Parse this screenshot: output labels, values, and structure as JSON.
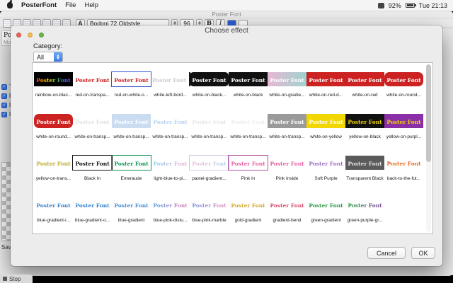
{
  "menubar": {
    "app_name": "PosterFont",
    "menus": [
      "File",
      "Help"
    ],
    "battery_percent": "92%",
    "clock": "Tue 21:13"
  },
  "window": {
    "title": "Poster Font",
    "toolbar": {
      "icons": [
        "new-document-icon",
        "open-icon",
        "save-icon",
        "export-icon",
        "color-icon",
        "effects-icon",
        "image-icon"
      ],
      "font_panel_label": "A",
      "font_name": "Bodoni 72 Oldstyle",
      "font_size": "96",
      "bold_label": "B",
      "italic_label": "I"
    },
    "sidebar": {
      "preview_text": "PosterFont",
      "multiline_label": "Multiline",
      "options": [
        {
          "label": "Text [M...",
          "checked": true
        },
        {
          "label": "Border",
          "checked": true
        },
        {
          "label": "Round",
          "checked": true
        },
        {
          "label": "Drop Sh...",
          "checked": true
        }
      ],
      "save_label": "Save in..."
    },
    "status": {
      "stop_label": "Stop"
    }
  },
  "dialog": {
    "title": "Choose effect",
    "category_label": "Category:",
    "category_value": "All",
    "cancel_label": "Cancel",
    "ok_label": "OK",
    "sample_text": "Poster Font",
    "effects": [
      {
        "label": "rainbow-on-blac...",
        "fg": "linear-gradient(90deg,#ff3333,#ffaa00,#ffee00,#33bb33,#3366ff,#aa44cc)",
        "bg": "#000000"
      },
      {
        "label": "red-on-transpa...",
        "fg": "#cc2222"
      },
      {
        "label": "red-on-white-o...",
        "fg": "#cc2222",
        "bg": "#ffffff",
        "border": "1px solid #3355cc"
      },
      {
        "label": "white-left-bord...",
        "fg": "#cccccc",
        "vbar": true
      },
      {
        "label": "white-on-black...",
        "fg": "#ffffff",
        "bg": "#111111",
        "radius": 5
      },
      {
        "label": "white-on-black",
        "fg": "#ffffff",
        "bg": "#111111"
      },
      {
        "label": "white-on-gradie...",
        "fg": "#ffffff",
        "bg": "linear-gradient(90deg,#e9b7d4,#9fd4cf)"
      },
      {
        "label": "white-on-red-d...",
        "fg": "#ffffff",
        "bg": "#cc2222"
      },
      {
        "label": "white-on-red",
        "fg": "#ffffff",
        "bg": "#cc2222"
      },
      {
        "label": "white-on-round...",
        "fg": "#ffffff",
        "bg": "#cc2222",
        "radius": 7
      },
      {
        "label": "white-on-round...",
        "fg": "#ffffff",
        "bg": "#cc2222",
        "radius": 7
      },
      {
        "label": "white-on-transp...",
        "fg": "#e2e2e2"
      },
      {
        "label": "white-on-transp...",
        "fg": "#ffffff",
        "bg": "#c9dcf0"
      },
      {
        "label": "white-on-transp...",
        "fg": "#b9d2ec"
      },
      {
        "label": "white-on-transp...",
        "fg": "#e6e6e6"
      },
      {
        "label": "white-on-transp...",
        "fg": "#ededed"
      },
      {
        "label": "white-on-transp...",
        "fg": "#ffffff",
        "bg": "#9a9a9a"
      },
      {
        "label": "white-on-yellow",
        "fg": "#ffffff",
        "bg": "#f2d600"
      },
      {
        "label": "yellow-on-black",
        "fg": "#f2d600",
        "bg": "#111111"
      },
      {
        "label": "yellow-on-purpl...",
        "fg": "#f2d600",
        "bg": "#8a2fa8"
      },
      {
        "label": "yellow-on-trans...",
        "fg": "#e0cc3e",
        "shadow": true
      },
      {
        "label": "Black In",
        "fg": "#111111",
        "border": "1px solid #111111"
      },
      {
        "label": "Emeraude",
        "fg": "#0e9455",
        "border": "1px solid #0e9455"
      },
      {
        "label": "light-blue-to-pi...",
        "fg": "linear-gradient(90deg,#8fd0ec,#f0b0d0)"
      },
      {
        "label": "pastel-gradient...",
        "fg": "linear-gradient(90deg,#f0c0d8,#b0d0ec)",
        "border": "1px solid #d4c4ea"
      },
      {
        "label": "Pink In",
        "fg": "#e860a0",
        "border": "1px solid #b050a0"
      },
      {
        "label": "Pink Inside",
        "fg": "#e860a0"
      },
      {
        "label": "Soft Purple",
        "fg": "#9a70c0"
      },
      {
        "label": "Transparent Black",
        "fg": "#e2e2e2",
        "bg": "#5a5a5a"
      },
      {
        "label": "back-to-the-fut...",
        "fg": "linear-gradient(180deg,#e03020,#f0a020)"
      },
      {
        "label": "blue-gradient-i...",
        "fg": "linear-gradient(180deg,#55b8e8,#2050b0)"
      },
      {
        "label": "blue-gradient-o...",
        "fg": "linear-gradient(180deg,#55b8e8,#2050b0)"
      },
      {
        "label": "blue-gradient",
        "fg": "linear-gradient(180deg,#66c4ee,#2860c0)"
      },
      {
        "label": "blue-pink-distu...",
        "fg": "linear-gradient(90deg,#58a8e0,#e878b8)"
      },
      {
        "label": "blue-pink-marble",
        "fg": "linear-gradient(90deg,#7898d8,#e890c0)"
      },
      {
        "label": "gold-gradient",
        "fg": "linear-gradient(180deg,#f0d060,#b8860b)"
      },
      {
        "label": "gradient-bend",
        "fg": "linear-gradient(180deg,#f080a0,#c02040)"
      },
      {
        "label": "green-gradient",
        "fg": "linear-gradient(180deg,#50c060,#107030)"
      },
      {
        "label": "green-purple-gr...",
        "fg": "linear-gradient(90deg,#30a040,#8040a0)"
      }
    ]
  },
  "colors": {
    "accent_blue": "#3d7ce8",
    "traffic_red": "#ee6156",
    "traffic_yellow": "#f5bd4f",
    "traffic_green": "#62ba46"
  }
}
